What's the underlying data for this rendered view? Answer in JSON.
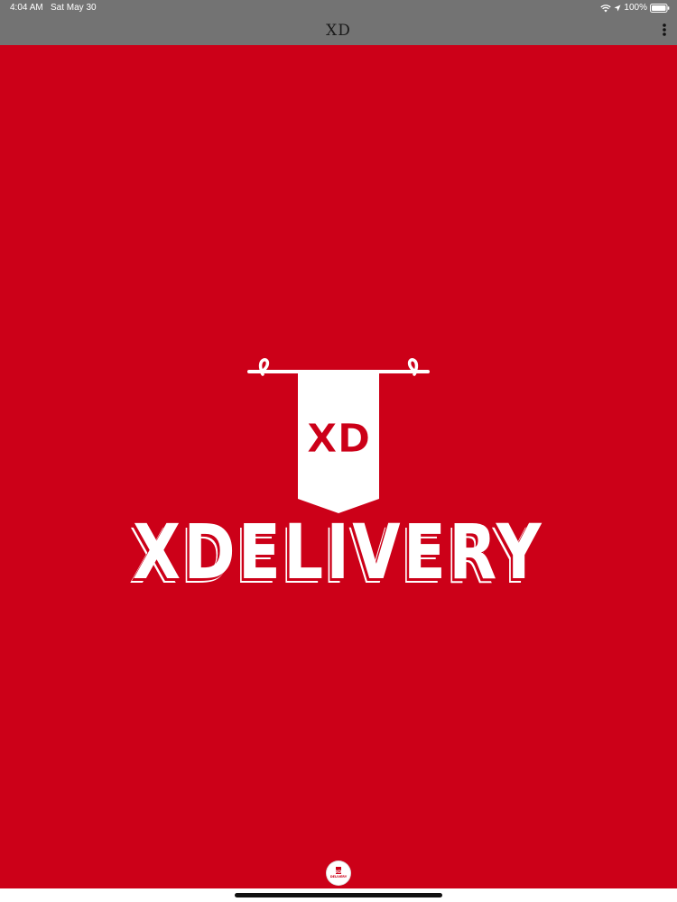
{
  "status_bar": {
    "time": "4:04 AM",
    "date": "Sat May 30",
    "battery": "100%",
    "icons": [
      "wifi-icon",
      "location-arrow-icon",
      "battery-icon"
    ]
  },
  "nav": {
    "title": "XD",
    "menu_icon": "more-vertical-icon"
  },
  "splash": {
    "banner_text": "XD",
    "brand_name": "XDELIVERY"
  },
  "bottom": {
    "avatar_icon": "xdelivery-logo-icon",
    "avatar_top": "XD",
    "avatar_bottom": "DELIVERY"
  },
  "colors": {
    "brand_red": "#cc0018",
    "top_bar": "#737373",
    "white": "#ffffff"
  }
}
